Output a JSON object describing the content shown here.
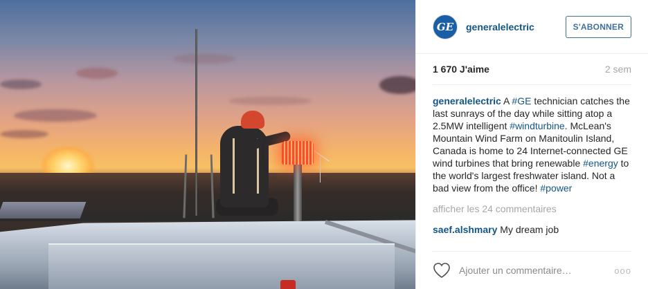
{
  "post": {
    "image": {
      "alt": ""
    },
    "header": {
      "avatar_text": "GE",
      "username": "generalelectric",
      "follow_label": "S'ABONNER"
    },
    "meta": {
      "likes": "1 670 J'aime",
      "time": "2 sem"
    },
    "caption": {
      "username": "generalelectric",
      "parts": [
        {
          "type": "text",
          "value": " A "
        },
        {
          "type": "tag",
          "value": "#GE"
        },
        {
          "type": "text",
          "value": " technician catches the last sunrays of the day while sitting atop a 2.5MW intelligent "
        },
        {
          "type": "tag",
          "value": "#windturbine"
        },
        {
          "type": "text",
          "value": ". McLean's Mountain Wind Farm on Manitoulin Island, Canada is home to 24 Internet-connected GE wind turbines that bring renewable "
        },
        {
          "type": "tag",
          "value": "#energy"
        },
        {
          "type": "text",
          "value": " to the world's largest freshwater island. Not a bad view from the office! "
        },
        {
          "type": "tag",
          "value": "#power"
        }
      ]
    },
    "more_comments": "afficher les 24 commentaires",
    "comments": [
      {
        "username": "saef.alshmary",
        "text": " My dream job"
      }
    ],
    "add_comment_placeholder": "Ajouter un commentaire…",
    "options_icon": "ooo",
    "colors": {
      "link": "#125688",
      "follow": "#3f729b",
      "muted": "#a5a7aa"
    }
  }
}
